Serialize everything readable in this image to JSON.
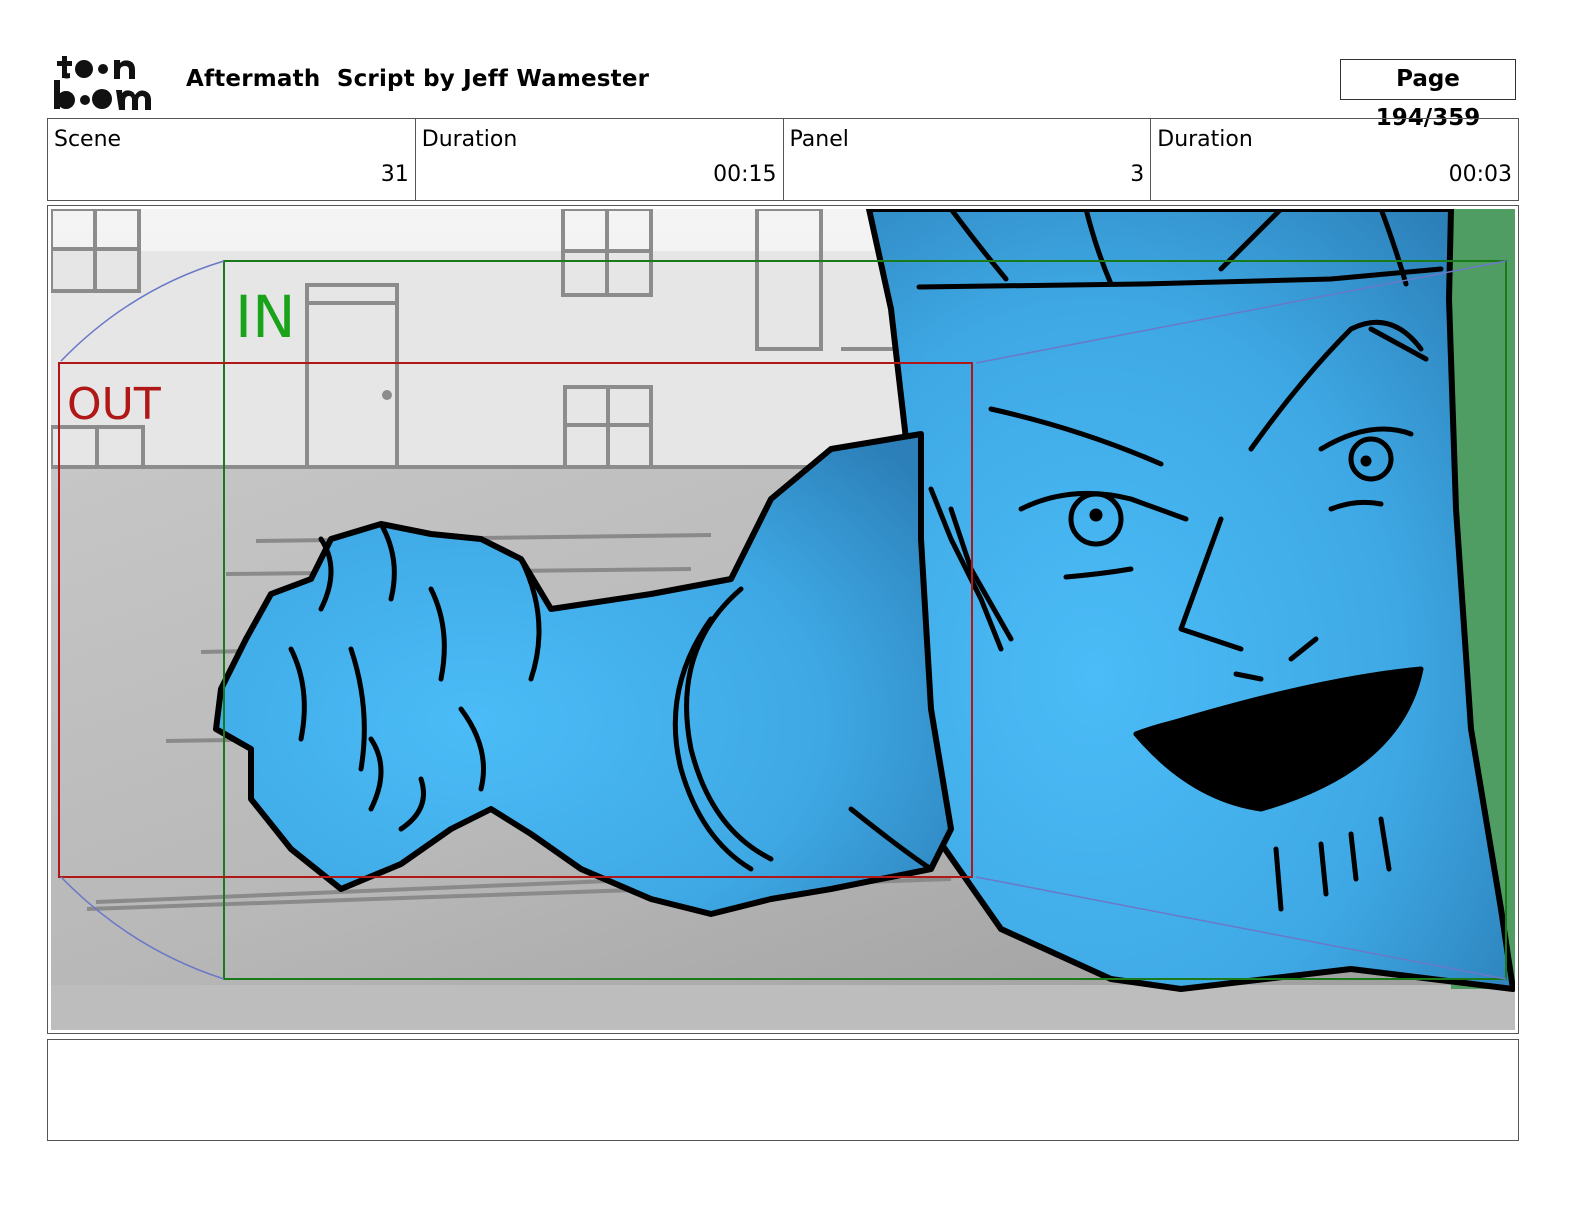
{
  "header": {
    "logo_text": "toon boom",
    "title": "Aftermath  Script by Jeff Wamester",
    "page": "Page 194/359"
  },
  "info": {
    "scene_label": "Scene",
    "scene_value": "31",
    "scene_duration_label": "Duration",
    "scene_duration_value": "00:15",
    "panel_label": "Panel",
    "panel_value": "3",
    "panel_duration_label": "Duration",
    "panel_duration_value": "00:03"
  },
  "panel": {
    "in_label": "IN",
    "out_label": "OUT",
    "colors": {
      "character_fill": "#46b6f2",
      "in_frame": "#1a7a1a",
      "out_frame": "#b01818",
      "camera_path": "#6a78c8"
    }
  },
  "notes": {
    "text": ""
  }
}
